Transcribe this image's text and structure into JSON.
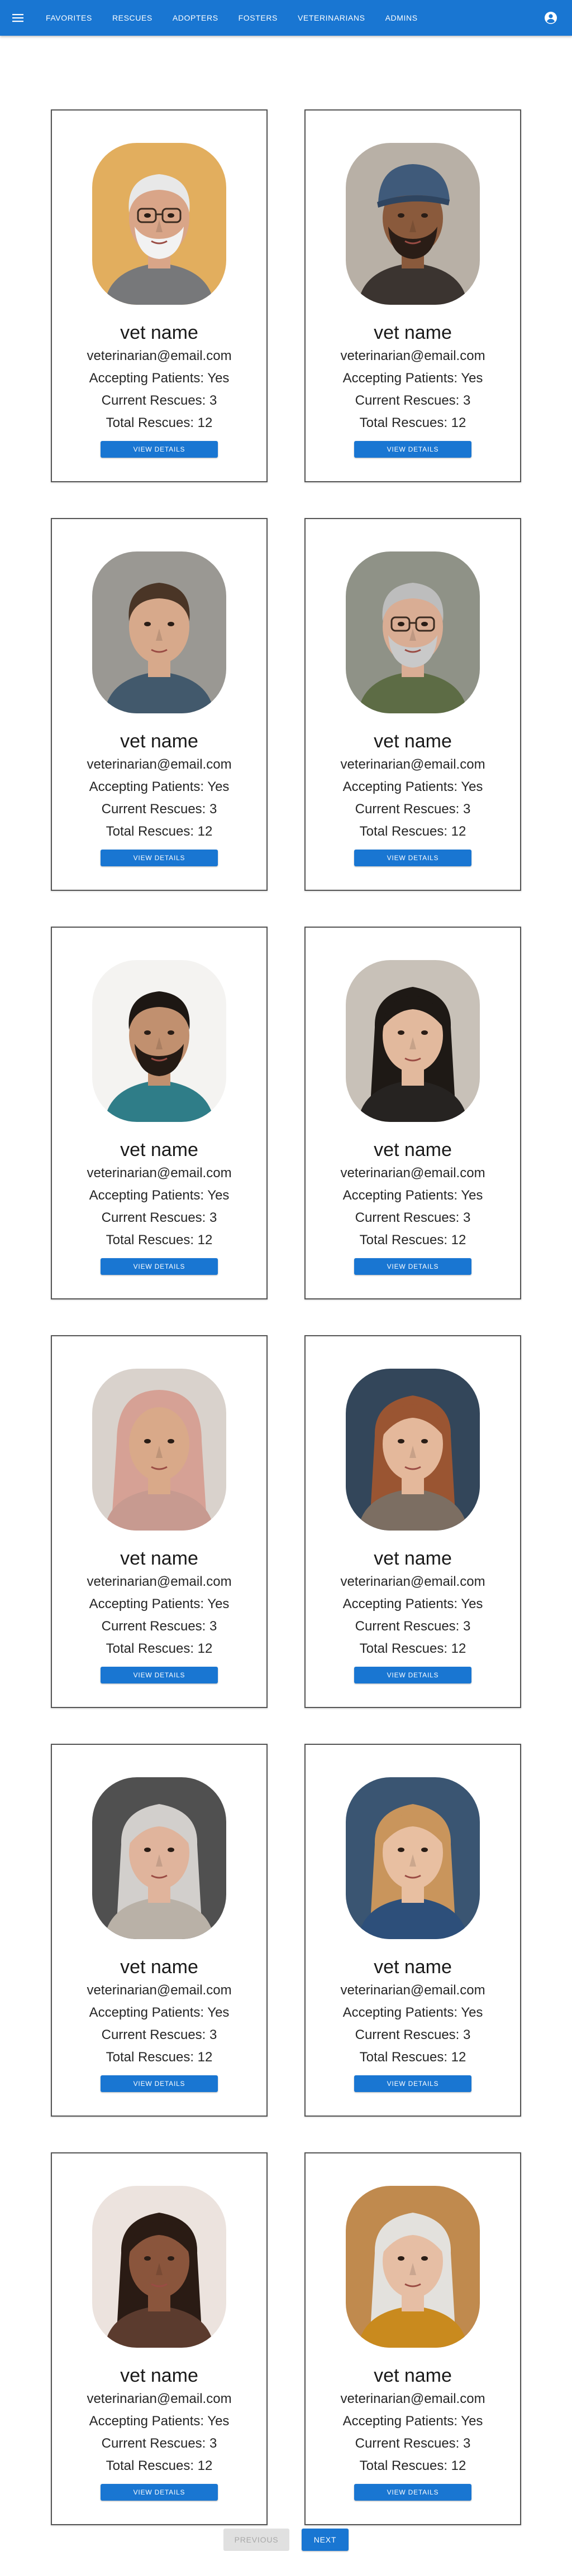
{
  "nav": {
    "items": [
      {
        "label": "Favorites"
      },
      {
        "label": "Rescues"
      },
      {
        "label": "Adopters"
      },
      {
        "label": "Fosters"
      },
      {
        "label": "Veterinarians"
      },
      {
        "label": "Admins"
      }
    ],
    "menu_icon": "menu-icon",
    "account_icon": "account-circle-icon"
  },
  "colors": {
    "primary": "#1976d2"
  },
  "vets": [
    {
      "name": "vet name",
      "email": "veterinarian@email.com",
      "accepting": "Accepting Patients: Yes",
      "current": "Current Rescues: 3",
      "total": "Total Rescues: 12",
      "button": "View Details",
      "photo": "elderly man with glasses"
    },
    {
      "name": "vet name",
      "email": "veterinarian@email.com",
      "accepting": "Accepting Patients: Yes",
      "current": "Current Rescues: 3",
      "total": "Total Rescues: 12",
      "button": "View Details",
      "photo": "man in flat cap"
    },
    {
      "name": "vet name",
      "email": "veterinarian@email.com",
      "accepting": "Accepting Patients: Yes",
      "current": "Current Rescues: 3",
      "total": "Total Rescues: 12",
      "button": "View Details",
      "photo": "young man with brown hair"
    },
    {
      "name": "vet name",
      "email": "veterinarian@email.com",
      "accepting": "Accepting Patients: Yes",
      "current": "Current Rescues: 3",
      "total": "Total Rescues: 12",
      "button": "View Details",
      "photo": "older man with glasses and mustache"
    },
    {
      "name": "vet name",
      "email": "veterinarian@email.com",
      "accepting": "Accepting Patients: Yes",
      "current": "Current Rescues: 3",
      "total": "Total Rescues: 12",
      "button": "View Details",
      "photo": "bearded young man"
    },
    {
      "name": "vet name",
      "email": "veterinarian@email.com",
      "accepting": "Accepting Patients: Yes",
      "current": "Current Rescues: 3",
      "total": "Total Rescues: 12",
      "button": "View Details",
      "photo": "woman with long black hair"
    },
    {
      "name": "vet name",
      "email": "veterinarian@email.com",
      "accepting": "Accepting Patients: Yes",
      "current": "Current Rescues: 3",
      "total": "Total Rescues: 12",
      "button": "View Details",
      "photo": "woman in pink hijab"
    },
    {
      "name": "vet name",
      "email": "veterinarian@email.com",
      "accepting": "Accepting Patients: Yes",
      "current": "Current Rescues: 3",
      "total": "Total Rescues: 12",
      "button": "View Details",
      "photo": "woman with auburn hair"
    },
    {
      "name": "vet name",
      "email": "veterinarian@email.com",
      "accepting": "Accepting Patients: Yes",
      "current": "Current Rescues: 3",
      "total": "Total Rescues: 12",
      "button": "View Details",
      "photo": "older woman with gray hair"
    },
    {
      "name": "vet name",
      "email": "veterinarian@email.com",
      "accepting": "Accepting Patients: Yes",
      "current": "Current Rescues: 3",
      "total": "Total Rescues: 12",
      "button": "View Details",
      "photo": "woman with blonde hair"
    },
    {
      "name": "vet name",
      "email": "veterinarian@email.com",
      "accepting": "Accepting Patients: Yes",
      "current": "Current Rescues: 3",
      "total": "Total Rescues: 12",
      "button": "View Details",
      "photo": "woman with curly dark hair"
    },
    {
      "name": "vet name",
      "email": "veterinarian@email.com",
      "accepting": "Accepting Patients: Yes",
      "current": "Current Rescues: 3",
      "total": "Total Rescues: 12",
      "button": "View Details",
      "photo": "smiling older woman with white hair"
    }
  ],
  "pagination": {
    "previous": "Previous",
    "next": "Next",
    "previous_disabled": true
  }
}
